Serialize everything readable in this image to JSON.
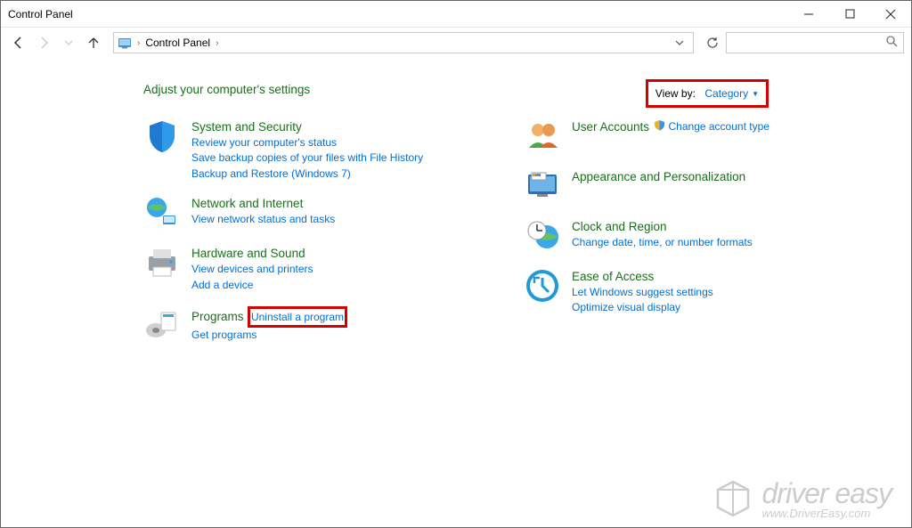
{
  "window": {
    "title": "Control Panel"
  },
  "address": {
    "crumb": "Control Panel"
  },
  "heading": "Adjust your computer's settings",
  "viewby": {
    "label": "View by:",
    "value": "Category"
  },
  "left": [
    {
      "title": "System and Security",
      "links": [
        "Review your computer's status",
        "Save backup copies of your files with File History",
        "Backup and Restore (Windows 7)"
      ]
    },
    {
      "title": "Network and Internet",
      "links": [
        "View network status and tasks"
      ]
    },
    {
      "title": "Hardware and Sound",
      "links": [
        "View devices and printers",
        "Add a device"
      ]
    },
    {
      "title": "Programs",
      "links": [
        "Uninstall a program",
        "Get programs"
      ]
    }
  ],
  "right": [
    {
      "title": "User Accounts",
      "links": [
        "Change account type"
      ]
    },
    {
      "title": "Appearance and Personalization",
      "links": []
    },
    {
      "title": "Clock and Region",
      "links": [
        "Change date, time, or number formats"
      ]
    },
    {
      "title": "Ease of Access",
      "links": [
        "Let Windows suggest settings",
        "Optimize visual display"
      ]
    }
  ],
  "watermark": {
    "brand": "driver easy",
    "url": "www.DriverEasy.com"
  }
}
